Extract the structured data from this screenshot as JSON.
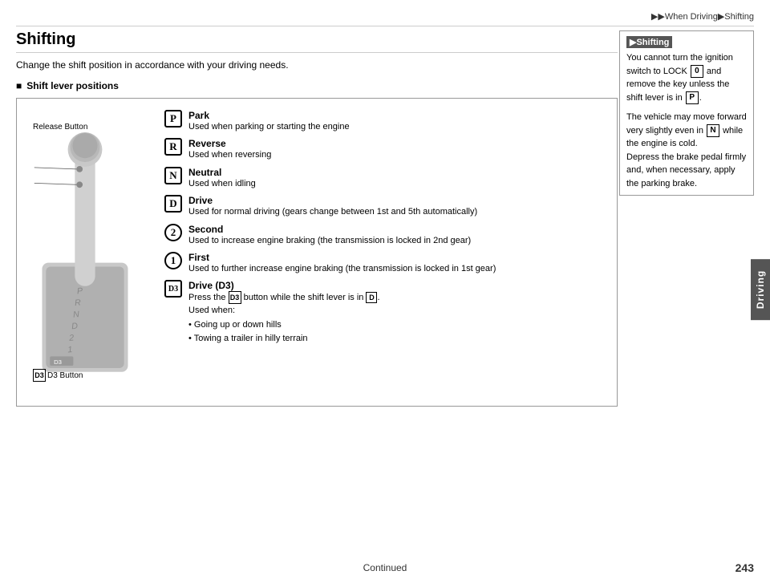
{
  "header": {
    "breadcrumb": "▶▶When Driving▶Shifting"
  },
  "main": {
    "title": "Shifting",
    "intro": "Change the shift position in accordance with your driving needs.",
    "section_heading": "Shift lever positions",
    "diagram_labels": {
      "release_button": "Release Button",
      "d3_button": "D3 Button"
    },
    "gear_items": [
      {
        "badge": "P",
        "name": "Park",
        "description": "Used when parking or starting the engine",
        "badge_type": "rounded"
      },
      {
        "badge": "R",
        "name": "Reverse",
        "description": "Used when reversing",
        "badge_type": "rounded"
      },
      {
        "badge": "N",
        "name": "Neutral",
        "description": "Used when idling",
        "badge_type": "rounded"
      },
      {
        "badge": "D",
        "name": "Drive",
        "description": "Used for normal driving (gears change between 1st and 5th automatically)",
        "badge_type": "rounded"
      },
      {
        "badge": "2",
        "name": "Second",
        "description": "Used to increase engine braking (the transmission is locked in 2nd gear)",
        "badge_type": "circle"
      },
      {
        "badge": "1",
        "name": "First",
        "description": "Used to further increase engine braking (the transmission is locked in 1st gear)",
        "badge_type": "circle"
      },
      {
        "badge": "D3",
        "name": "Drive (D3)",
        "description_parts": [
          "Press the D3 button while the shift lever is in D.",
          "Used when:",
          "• Going up or down hills",
          "• Towing a trailer in hilly terrain"
        ],
        "badge_type": "d3"
      }
    ]
  },
  "sidebar": {
    "note_title": "▶Shifting",
    "note_text_1": "You cannot turn the ignition switch to LOCK",
    "lock_badge": "0",
    "note_text_2": "and remove the key unless the shift lever is in",
    "p_badge": "P",
    "note_text_3": ".",
    "extra_text_1": "The vehicle may move forward very slightly even in",
    "n_badge": "N",
    "extra_text_2": "while the engine is cold.",
    "extra_text_3": "Depress the brake pedal firmly and, when necessary, apply the parking brake."
  },
  "driving_tab": "Driving",
  "footer": {
    "continued": "Continued",
    "page_number": "243"
  }
}
